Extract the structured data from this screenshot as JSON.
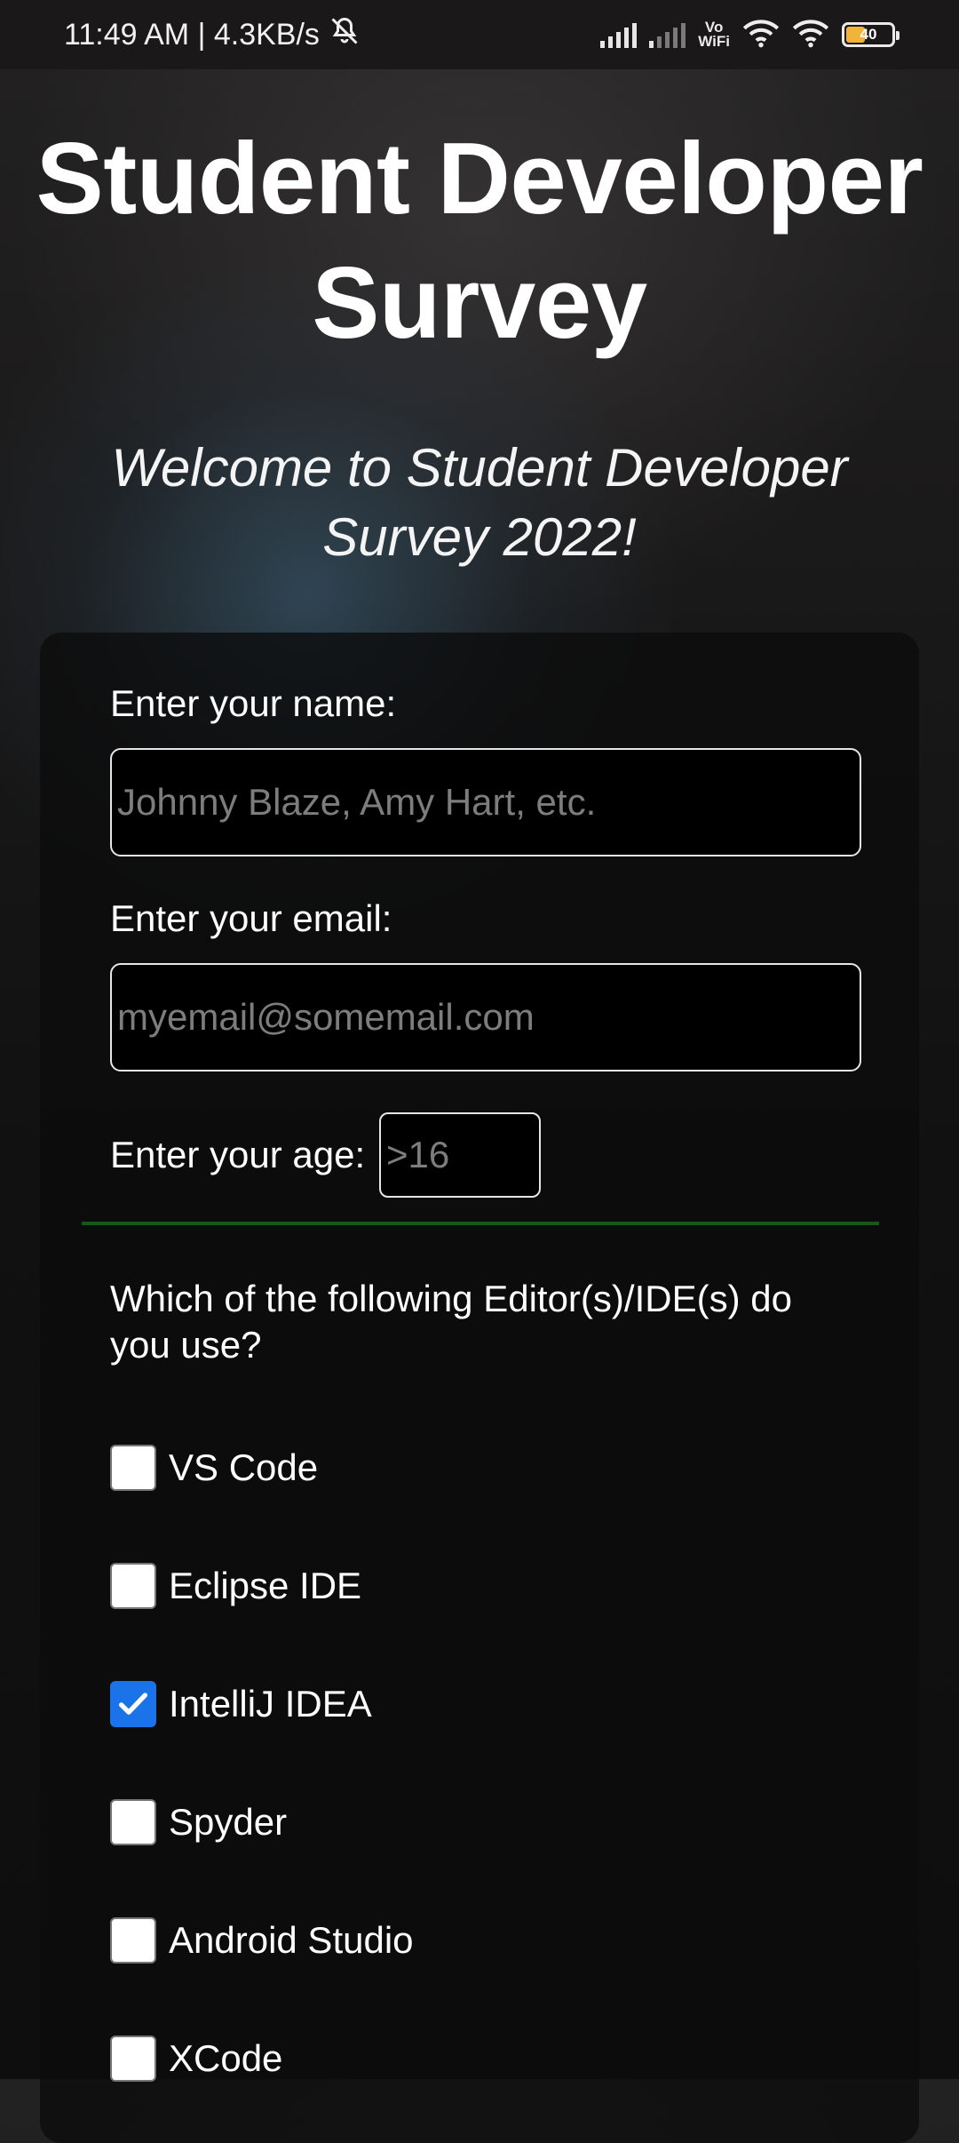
{
  "status_bar": {
    "time_speed": "11:49 AM | 4.3KB/s",
    "icons": [
      "mute-icon",
      "signal-icon",
      "signal-icon",
      "vowifi-icon",
      "wifi-icon",
      "wifi-icon",
      "battery-icon"
    ],
    "vowifi_line1": "Vo",
    "vowifi_line2": "WiFi",
    "battery_level": "40"
  },
  "header": {
    "title": "Student Developer Survey",
    "subtitle": "Welcome to Student Developer Survey 2022!"
  },
  "form": {
    "name_label": "Enter your name:",
    "name_placeholder": "Johnny Blaze, Amy Hart, etc.",
    "name_value": "",
    "email_label": "Enter your email:",
    "email_placeholder": "myemail@somemail.com",
    "email_value": "",
    "age_label": "Enter your age:",
    "age_placeholder": ">16",
    "age_value": "",
    "ide_question": "Which of the following Editor(s)/IDE(s) do you use?",
    "ide_options": [
      {
        "label": "VS Code",
        "checked": false
      },
      {
        "label": "Eclipse IDE",
        "checked": false
      },
      {
        "label": "IntelliJ IDEA",
        "checked": true
      },
      {
        "label": "Spyder",
        "checked": false
      },
      {
        "label": "Android Studio",
        "checked": false
      },
      {
        "label": "XCode",
        "checked": false
      }
    ]
  },
  "colors": {
    "checkbox_checked": "#1a73e8",
    "divider": "#155a15",
    "battery_fill": "#f2b33a"
  }
}
